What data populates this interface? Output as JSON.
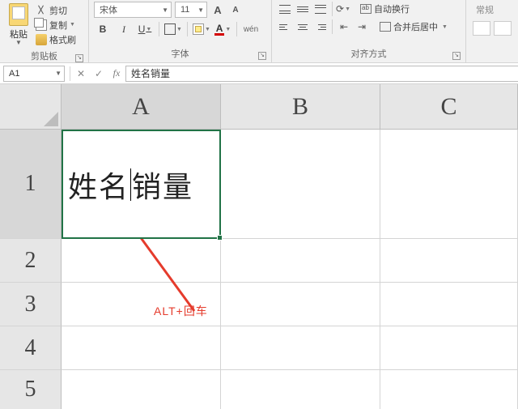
{
  "ribbon": {
    "clipboard": {
      "paste": "粘贴",
      "cut": "剪切",
      "copy": "复制",
      "format_painter": "格式刷",
      "group": "剪贴板"
    },
    "font": {
      "name": "宋体",
      "size": "11",
      "group": "字体"
    },
    "alignment": {
      "wrap": "自动换行",
      "merge": "合并后居中",
      "group": "对齐方式"
    },
    "styles": {
      "label": "常规"
    }
  },
  "fx": {
    "cellref": "A1",
    "formula": "姓名销量"
  },
  "grid": {
    "cols": {
      "A": "A",
      "B": "B",
      "C": "C"
    },
    "rows": {
      "r1": "1",
      "r2": "2",
      "r3": "3",
      "r4": "4",
      "r5": "5"
    },
    "A1_left": "姓名",
    "A1_right": "销量"
  },
  "annotation": {
    "text": "ALT+回车"
  }
}
